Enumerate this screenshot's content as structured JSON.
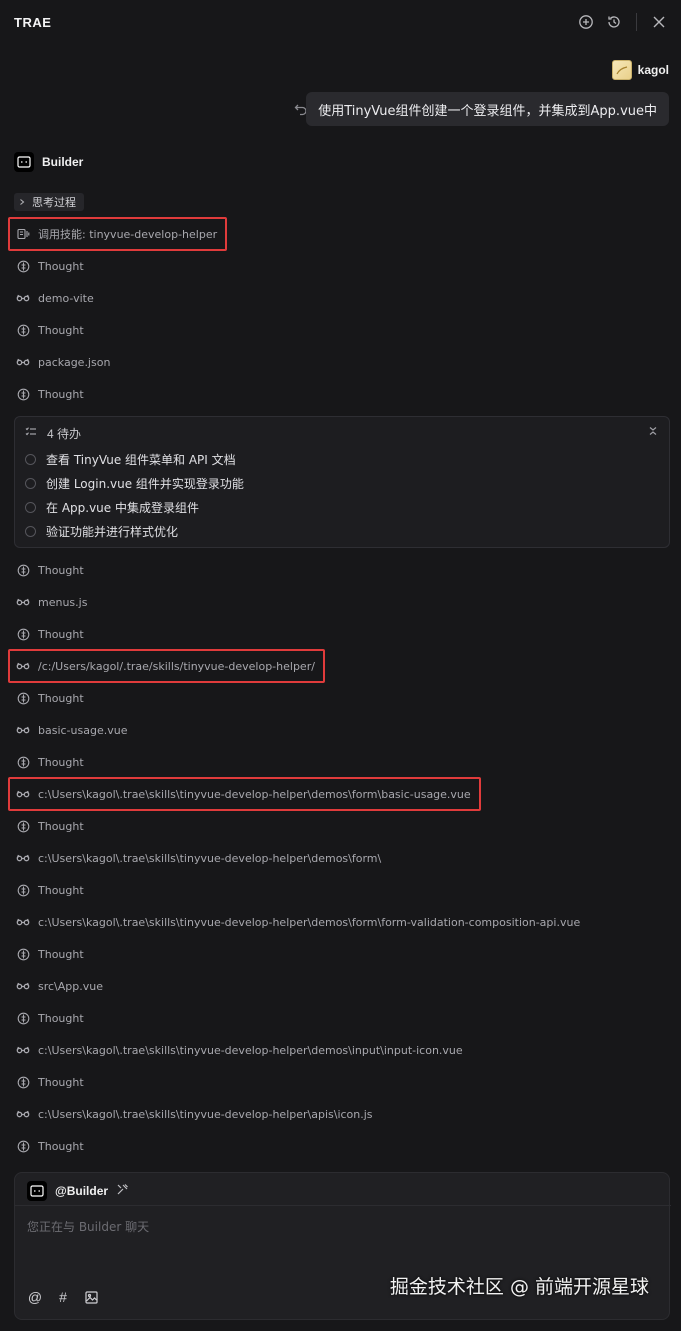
{
  "header": {
    "title": "TRAE"
  },
  "user": {
    "name": "kagol"
  },
  "user_message": "使用TinyVue组件创建一个登录组件，并集成到App.vue中",
  "builder": {
    "label": "Builder"
  },
  "think_process": {
    "label": "思考过程"
  },
  "steps": [
    {
      "icon": "skill-icon",
      "text": "调用技能: tinyvue-develop-helper",
      "highlight": true
    },
    {
      "icon": "thought-icon",
      "text": "Thought"
    },
    {
      "icon": "view-icon",
      "text": "demo-vite"
    },
    {
      "icon": "thought-icon",
      "text": "Thought"
    },
    {
      "icon": "view-icon",
      "text": "package.json"
    },
    {
      "icon": "thought-icon",
      "text": "Thought"
    }
  ],
  "todo": {
    "title": "4 待办",
    "items": [
      "查看 TinyVue 组件菜单和 API 文档",
      "创建 Login.vue 组件并实现登录功能",
      "在 App.vue 中集成登录组件",
      "验证功能并进行样式优化"
    ]
  },
  "steps2": [
    {
      "icon": "thought-icon",
      "text": "Thought"
    },
    {
      "icon": "view-icon",
      "text": "menus.js"
    },
    {
      "icon": "thought-icon",
      "text": "Thought"
    },
    {
      "icon": "view-icon",
      "text": "/c:/Users/kagol/.trae/skills/tinyvue-develop-helper/",
      "highlight": true
    },
    {
      "icon": "thought-icon",
      "text": "Thought"
    },
    {
      "icon": "view-icon",
      "text": "basic-usage.vue"
    },
    {
      "icon": "thought-icon",
      "text": "Thought"
    },
    {
      "icon": "view-icon",
      "text": "c:\\Users\\kagol\\.trae\\skills\\tinyvue-develop-helper\\demos\\form\\basic-usage.vue",
      "highlight": true
    },
    {
      "icon": "thought-icon",
      "text": "Thought"
    },
    {
      "icon": "view-icon",
      "text": "c:\\Users\\kagol\\.trae\\skills\\tinyvue-develop-helper\\demos\\form\\"
    },
    {
      "icon": "thought-icon",
      "text": "Thought"
    },
    {
      "icon": "view-icon",
      "text": "c:\\Users\\kagol\\.trae\\skills\\tinyvue-develop-helper\\demos\\form\\form-validation-composition-api.vue"
    },
    {
      "icon": "thought-icon",
      "text": "Thought"
    },
    {
      "icon": "view-icon",
      "text": "src\\App.vue"
    },
    {
      "icon": "thought-icon",
      "text": "Thought"
    },
    {
      "icon": "view-icon",
      "text": "c:\\Users\\kagol\\.trae\\skills\\tinyvue-develop-helper\\demos\\input\\input-icon.vue"
    },
    {
      "icon": "thought-icon",
      "text": "Thought"
    },
    {
      "icon": "view-icon",
      "text": "c:\\Users\\kagol\\.trae\\skills\\tinyvue-develop-helper\\apis\\icon.js"
    },
    {
      "icon": "thought-icon",
      "text": "Thought"
    }
  ],
  "composer": {
    "agent": "@Builder",
    "placeholder": "您正在与 Builder 聊天",
    "tools": [
      "@",
      "#",
      "image-icon"
    ]
  },
  "watermark": "掘金技术社区 @ 前端开源星球",
  "colors": {
    "background": "#171719",
    "highlight": "#e03b3b",
    "bubble": "#2a2a2e"
  }
}
